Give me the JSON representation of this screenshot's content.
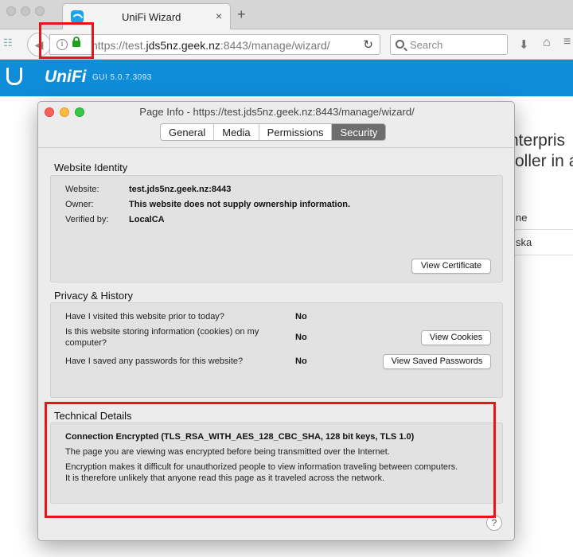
{
  "browser": {
    "tab_title": "UniFi Wizard",
    "tab_close": "×",
    "newtab": "+",
    "url_prefix": "https://test.",
    "url_host": "jds5nz.geek.nz",
    "url_suffix": ":8443/manage/wizard/",
    "search_placeholder": "Search",
    "colors": {
      "highlight": "#e8141b",
      "lock": "#1fa21f"
    }
  },
  "page": {
    "brand": "UniFi",
    "gui_version": "GUI 5.0.7.3093",
    "bg_text": [
      "nterpris",
      "roller in a",
      "ne",
      "ska"
    ],
    "bar_color": "#0f8dd9"
  },
  "dialog": {
    "title": "Page Info - https://test.jds5nz.geek.nz:8443/manage/wizard/",
    "tabs": [
      "General",
      "Media",
      "Permissions",
      "Security"
    ],
    "active_tab": "Security",
    "website_identity": {
      "heading": "Website Identity",
      "rows": [
        {
          "label": "Website:",
          "value": "test.jds5nz.geek.nz:8443"
        },
        {
          "label": "Owner:",
          "value": "This website does not supply ownership information."
        },
        {
          "label": "Verified by:",
          "value": "LocalCA"
        }
      ],
      "button": "View Certificate"
    },
    "privacy": {
      "heading": "Privacy & History",
      "rows": [
        {
          "question": "Have I visited this website prior to today?",
          "answer": "No"
        },
        {
          "question_line1": "Is this website storing information (cookies) on my",
          "question_line2": "computer?",
          "answer": "No",
          "button": "View Cookies"
        },
        {
          "question": "Have I saved any passwords for this website?",
          "answer": "No",
          "button": "View Saved Passwords"
        }
      ]
    },
    "technical": {
      "heading": "Technical Details",
      "title": "Connection Encrypted (TLS_RSA_WITH_AES_128_CBC_SHA, 128 bit keys, TLS 1.0)",
      "line1": "The page you are viewing was encrypted before being transmitted over the Internet.",
      "line2": "Encryption makes it difficult for unauthorized people to view information traveling between computers.",
      "line3": "It is therefore unlikely that anyone read this page as it traveled across the network."
    },
    "help": "?"
  }
}
